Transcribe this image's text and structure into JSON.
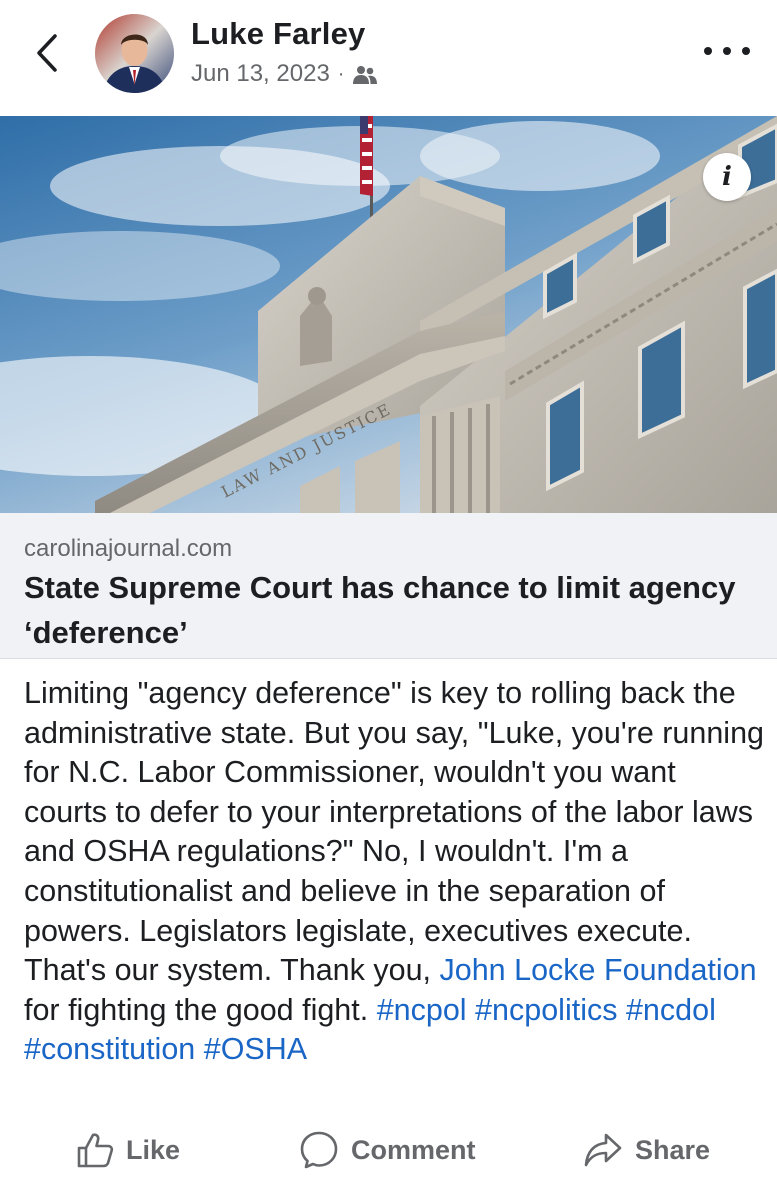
{
  "post": {
    "author": "Luke Farley",
    "date": "Jun 13, 2023",
    "separator": "·",
    "audience_icon": "friends-icon",
    "link": {
      "domain": "carolinajournal.com",
      "title": "State Supreme Court has chance to limit agency ‘deference’",
      "image_engraving": "LAW AND JUSTICE"
    },
    "text_main": "Limiting \"agency deference\" is key to rolling back the administrative state. But you say, \"Luke, you're running for N.C. Labor Commissioner, wouldn't you want courts to defer to your interpretations of the labor laws and OSHA regulations?\" No, I wouldn't. I'm a constitutionalist and believe in the separation of powers. Legislators legislate, executives execute. That's our system. Thank you, ",
    "mention": "John Locke Foundation",
    "text_after_mention": " for fighting the good fight.",
    "hashtags": [
      "#ncpol",
      "#ncpolitics",
      "#ncdol",
      "#constitution",
      "#OSHA"
    ]
  },
  "actions": {
    "like_label": "Like",
    "comment_label": "Comment",
    "share_label": "Share"
  },
  "colors": {
    "link_blue": "#1a66c7",
    "secondary_text": "#65676b",
    "caption_bg": "#f0f2f5"
  }
}
